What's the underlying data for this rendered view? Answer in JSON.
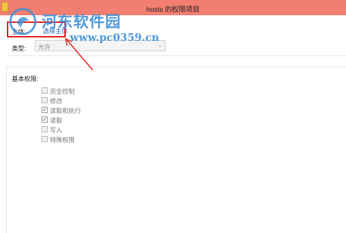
{
  "window": {
    "title": "hosts 的权限项目"
  },
  "watermark": {
    "site_name": "河东软件园",
    "url": "www.pc0359.cn"
  },
  "principal": {
    "label": "主体:",
    "link_text": "选择主体"
  },
  "type": {
    "label": "类型:",
    "selected": "允许"
  },
  "permissions": {
    "heading": "基本权限:",
    "items": [
      {
        "label": "完全控制",
        "checked": false
      },
      {
        "label": "修改",
        "checked": false
      },
      {
        "label": "读取和执行",
        "checked": true
      },
      {
        "label": "读取",
        "checked": true
      },
      {
        "label": "写入",
        "checked": false
      },
      {
        "label": "特殊权限",
        "checked": false
      }
    ]
  },
  "colors": {
    "titlebar": "#f27e72",
    "annotation": "#e01818",
    "watermark": "#3b8ed6",
    "link": "#1a5fb4"
  }
}
